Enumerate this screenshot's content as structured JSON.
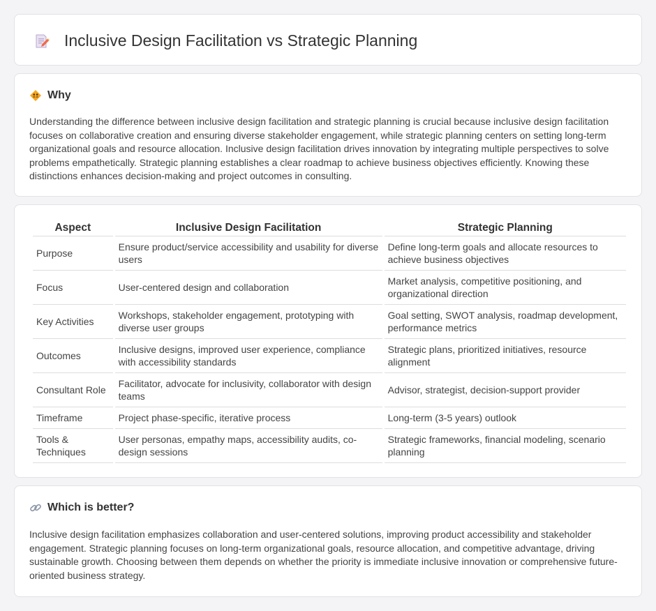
{
  "header": {
    "title": "Inclusive Design Facilitation vs Strategic Planning",
    "icon": "document-pencil-icon"
  },
  "why": {
    "heading": "Why",
    "icon": "diamond-people-icon",
    "text": "Understanding the difference between inclusive design facilitation and strategic planning is crucial because inclusive design facilitation focuses on collaborative creation and ensuring diverse stakeholder engagement, while strategic planning centers on setting long-term organizational goals and resource allocation. Inclusive design facilitation drives innovation by integrating multiple perspectives to solve problems empathetically. Strategic planning establishes a clear roadmap to achieve business objectives efficiently. Knowing these distinctions enhances decision-making and project outcomes in consulting."
  },
  "comparison": {
    "headers": [
      "Aspect",
      "Inclusive Design Facilitation",
      "Strategic Planning"
    ],
    "rows": [
      [
        "Purpose",
        "Ensure product/service accessibility and usability for diverse users",
        "Define long-term goals and allocate resources to achieve business objectives"
      ],
      [
        "Focus",
        "User-centered design and collaboration",
        "Market analysis, competitive positioning, and organizational direction"
      ],
      [
        "Key Activities",
        "Workshops, stakeholder engagement, prototyping with diverse user groups",
        "Goal setting, SWOT analysis, roadmap development, performance metrics"
      ],
      [
        "Outcomes",
        "Inclusive designs, improved user experience, compliance with accessibility standards",
        "Strategic plans, prioritized initiatives, resource alignment"
      ],
      [
        "Consultant Role",
        "Facilitator, advocate for inclusivity, collaborator with design teams",
        "Advisor, strategist, decision-support provider"
      ],
      [
        "Timeframe",
        "Project phase-specific, iterative process",
        "Long-term (3-5 years) outlook"
      ],
      [
        "Tools & Techniques",
        "User personas, empathy maps, accessibility audits, co-design sessions",
        "Strategic frameworks, financial modeling, scenario planning"
      ]
    ]
  },
  "better": {
    "heading": "Which is better?",
    "icon": "link-icon",
    "text": "Inclusive design facilitation emphasizes collaboration and user-centered solutions, improving product accessibility and stakeholder engagement. Strategic planning focuses on long-term organizational goals, resource allocation, and competitive advantage, driving sustainable growth. Choosing between them depends on whether the priority is immediate inclusive innovation or comprehensive future-oriented business strategy."
  }
}
